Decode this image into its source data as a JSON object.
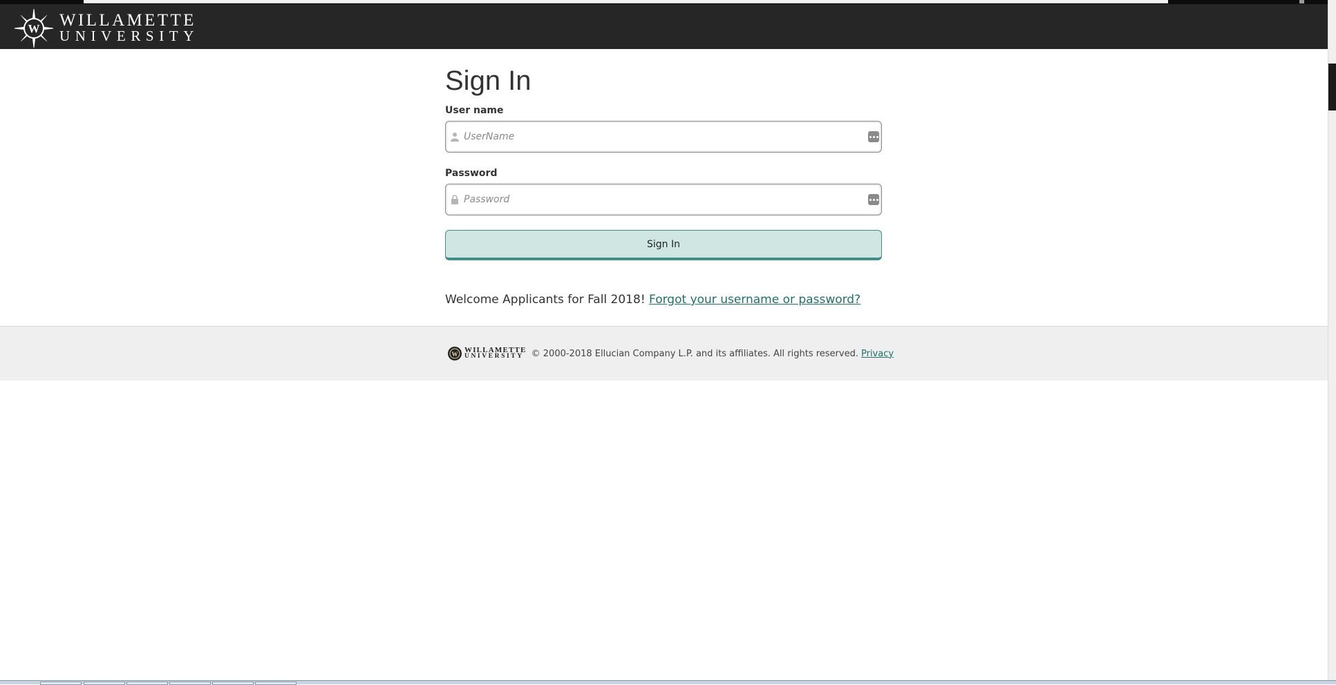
{
  "header": {
    "logo_line1": "WILLAMETTE",
    "logo_line2": "UNIVERSITY",
    "logo_icon": "compass-w-seal-icon"
  },
  "form": {
    "title": "Sign In",
    "username_label": "User name",
    "username_placeholder": "UserName",
    "username_value": "",
    "password_label": "Password",
    "password_placeholder": "Password",
    "password_value": "",
    "submit_label": "Sign In"
  },
  "welcome": {
    "text": "Welcome Applicants for Fall 2018!",
    "link": "Forgot your username or password?"
  },
  "footer": {
    "logo_line1": "WILLAMETTE",
    "logo_line2": "UNIVERSITY",
    "copyright": "© 2000-2018 Ellucian Company L.P. and its affiliates. All rights reserved.",
    "privacy": "Privacy"
  },
  "colors": {
    "header_bg": "#262626",
    "accent": "#1f6f6a",
    "button_bg": "#cfe6e2",
    "button_border": "#3f8f86",
    "footer_bg": "#efefef"
  }
}
